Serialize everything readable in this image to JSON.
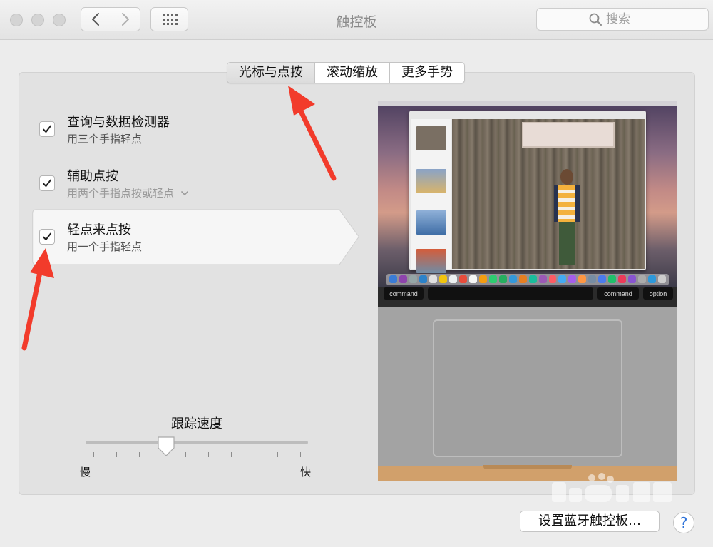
{
  "window": {
    "title": "触控板",
    "search": {
      "placeholder": "搜索",
      "value": ""
    }
  },
  "tabs": [
    {
      "label": "光标与点按",
      "active": true
    },
    {
      "label": "滚动缩放",
      "active": false
    },
    {
      "label": "更多手势",
      "active": false
    }
  ],
  "options": [
    {
      "title": "查询与数据检测器",
      "subtitle": "用三个手指轻点",
      "checked": true,
      "selected": false
    },
    {
      "title": "辅助点按",
      "subtitle": "用两个手指点按或轻点",
      "checked": true,
      "selected": false,
      "has_dropdown": true
    },
    {
      "title": "轻点来点按",
      "subtitle": "用一个手指轻点",
      "checked": true,
      "selected": true
    }
  ],
  "tracking_speed": {
    "label": "跟踪速度",
    "min_label": "慢",
    "max_label": "快",
    "value_fraction": 0.35,
    "ticks": 10
  },
  "preview": {
    "keys": [
      "command",
      "command",
      "option"
    ]
  },
  "bottom": {
    "bluetooth_button": "设置蓝牙触控板…",
    "help": "?"
  },
  "colors": {
    "annotation_arrow": "#f23b2b",
    "help_accent": "#2e73d9"
  }
}
